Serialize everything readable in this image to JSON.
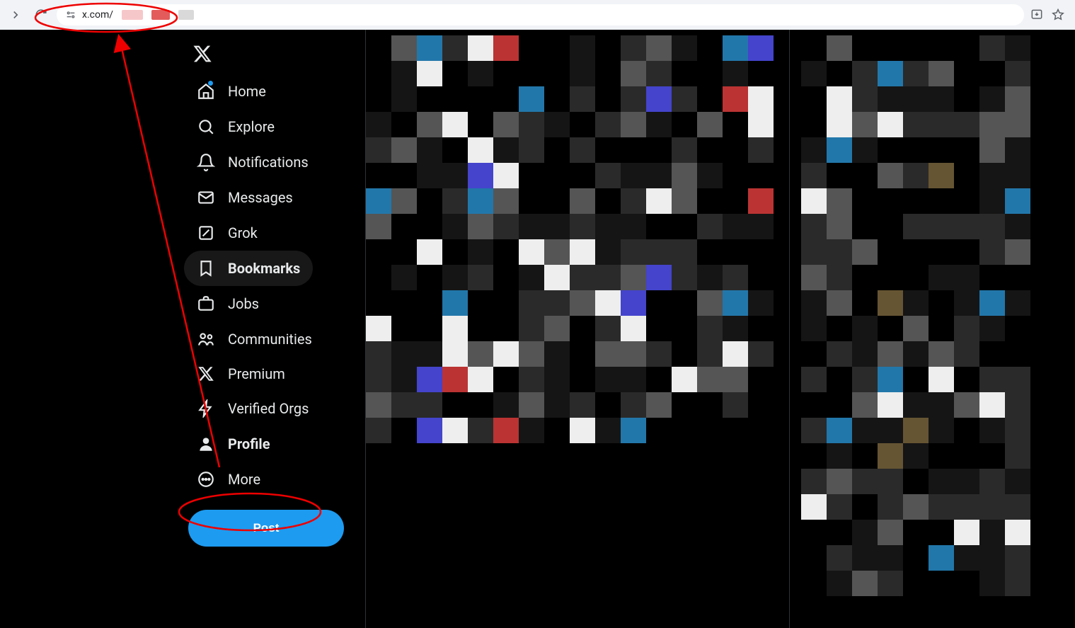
{
  "browser": {
    "url_visible": "x.com/"
  },
  "sidebar": {
    "items": [
      {
        "label": "Home"
      },
      {
        "label": "Explore"
      },
      {
        "label": "Notifications"
      },
      {
        "label": "Messages"
      },
      {
        "label": "Grok"
      },
      {
        "label": "Bookmarks"
      },
      {
        "label": "Jobs"
      },
      {
        "label": "Communities"
      },
      {
        "label": "Premium"
      },
      {
        "label": "Verified Orgs"
      },
      {
        "label": "Profile"
      },
      {
        "label": "More"
      }
    ],
    "active_index": 5,
    "post_button": "Post"
  }
}
